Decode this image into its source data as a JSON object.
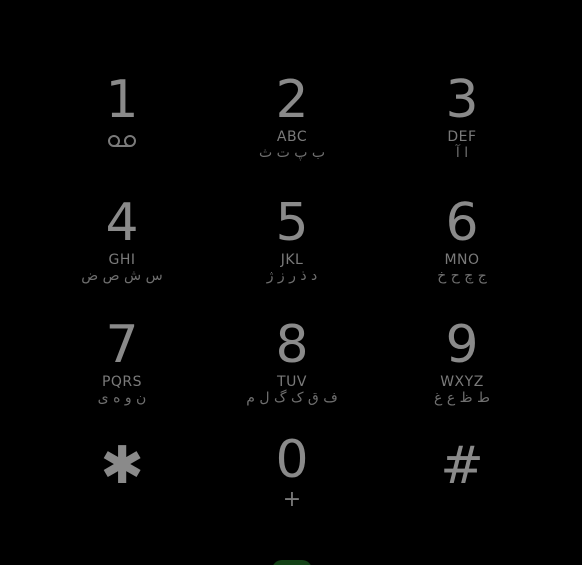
{
  "dialpad": {
    "keys": [
      {
        "digit": "1",
        "letters": "",
        "alt": "",
        "icon": "voicemail-icon"
      },
      {
        "digit": "2",
        "letters": "ABC",
        "alt": "ب پ ت ث"
      },
      {
        "digit": "3",
        "letters": "DEF",
        "alt": "ا آ"
      },
      {
        "digit": "4",
        "letters": "GHI",
        "alt": "س ش ص ض"
      },
      {
        "digit": "5",
        "letters": "JKL",
        "alt": "د ذ ر ز ژ"
      },
      {
        "digit": "6",
        "letters": "MNO",
        "alt": "ج چ ح خ"
      },
      {
        "digit": "7",
        "letters": "PQRS",
        "alt": "ن و ه ی"
      },
      {
        "digit": "8",
        "letters": "TUV",
        "alt": "ف ق ک گ ل م"
      },
      {
        "digit": "9",
        "letters": "WXYZ",
        "alt": "ط ظ ع غ"
      },
      {
        "digit": "✱",
        "letters": "",
        "alt": ""
      },
      {
        "digit": "0",
        "letters": "+",
        "alt": ""
      },
      {
        "digit": "#",
        "letters": "",
        "alt": ""
      }
    ]
  },
  "colors": {
    "background": "#000000",
    "key_text": "#8a8a8a",
    "call_button": "#1b5e20"
  }
}
